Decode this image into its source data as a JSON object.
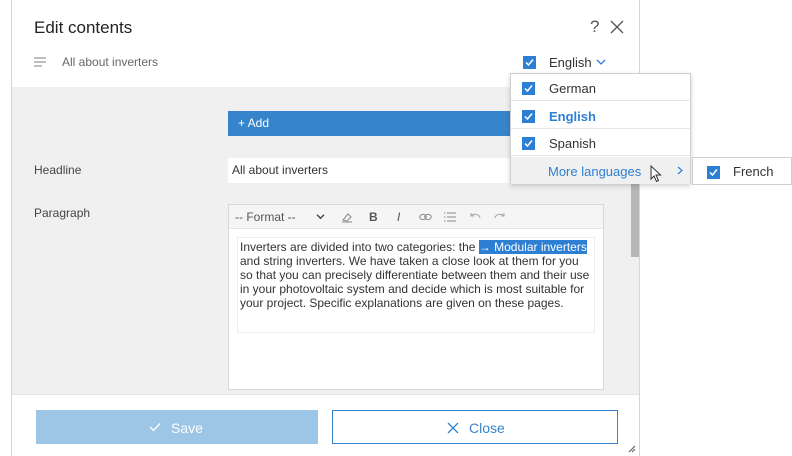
{
  "modal": {
    "title": "Edit contents",
    "help_label": "?",
    "breadcrumb": "All about inverters",
    "language": {
      "selected": "English",
      "checked": true
    }
  },
  "form": {
    "add_label": "+ Add",
    "headline_label": "Headline",
    "headline_value": "All about inverters",
    "paragraph_label": "Paragraph",
    "toolbar": {
      "format_label": "-- Format --",
      "bold": "B",
      "italic": "I"
    },
    "paragraph": {
      "before": "Inverters are divided into two categories: the ",
      "highlight": "→ Modular inverters",
      "after": " and string inverters. We have taken a close look at them for you so that you can precisely differentiate between them and their use in your photovoltaic system and decide which is most suitable for your project. Specific explanations are given on these pages."
    }
  },
  "footer": {
    "save_label": "Save",
    "close_label": "Close"
  },
  "language_dropdown": {
    "items": [
      {
        "label": "German",
        "checked": true
      },
      {
        "label": "English",
        "checked": true,
        "active": true
      },
      {
        "label": "Spanish",
        "checked": true
      }
    ],
    "more_label": "More languages",
    "submenu": [
      {
        "label": "French",
        "checked": true
      }
    ]
  },
  "colors": {
    "accent": "#2d7fd3",
    "add_bar": "#3685cc",
    "save_disabled": "#9dc5e6",
    "body_bg": "#f0f0f0"
  }
}
